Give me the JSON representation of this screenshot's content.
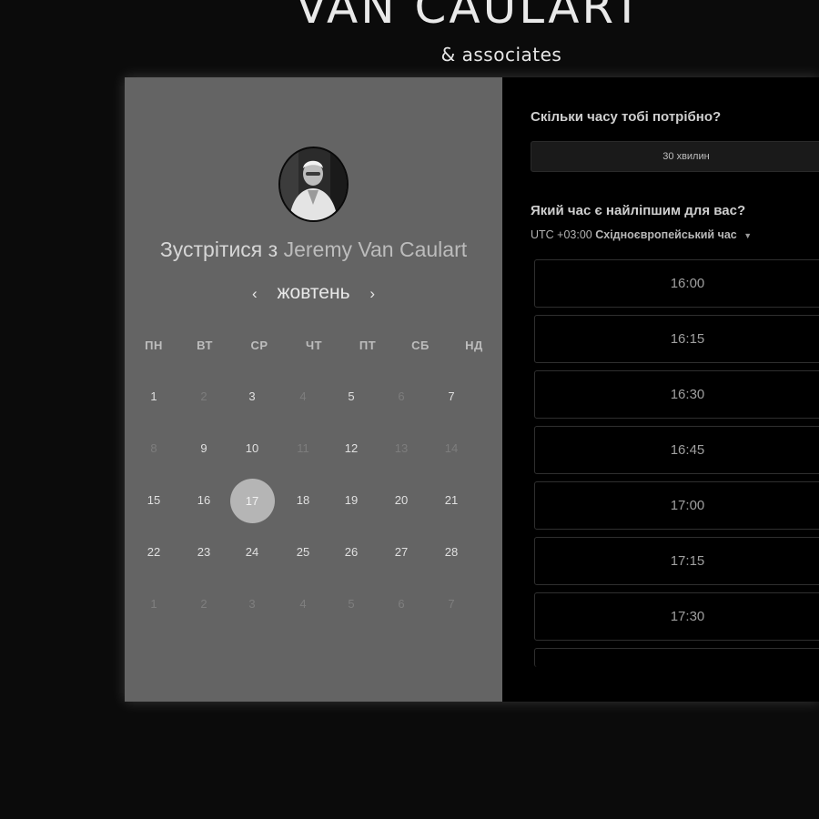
{
  "brand": {
    "title": "VAN CAULART",
    "subtitle": "& associates"
  },
  "calendar": {
    "avatar_icon": "person-photo",
    "meet_prefix": "Зустрітися з",
    "meet_name": "Jeremy Van Caulart",
    "month": "жовтень",
    "prev_icon": "‹",
    "next_icon": "›",
    "weekdays": [
      "ПН",
      "ВТ",
      "СР",
      "ЧТ",
      "ПТ",
      "СБ",
      "НД"
    ],
    "weeks": [
      [
        "1",
        "2",
        "3",
        "4",
        "5",
        "6",
        "7"
      ],
      [
        "8",
        "9",
        "10",
        "11",
        "12",
        "13",
        "14"
      ],
      [
        "15",
        "16",
        "17",
        "18",
        "19",
        "20",
        "21"
      ],
      [
        "22",
        "23",
        "24",
        "25",
        "26",
        "27",
        "28"
      ],
      [
        "1",
        "2",
        "3",
        "4",
        "5",
        "6",
        "7"
      ]
    ],
    "selected_day": "17"
  },
  "booking": {
    "duration_question": "Скільки часу тобі потрібно?",
    "duration_value": "30 хвилин",
    "time_question": "Який час є найліпшим для вас?",
    "timezone_offset": "UTC +03:00",
    "timezone_name": "Східноєвропейський час",
    "timezone_caret_icon": "caret-down",
    "slots": [
      "16:00",
      "16:15",
      "16:30",
      "16:45",
      "17:00",
      "17:15",
      "17:30"
    ]
  }
}
